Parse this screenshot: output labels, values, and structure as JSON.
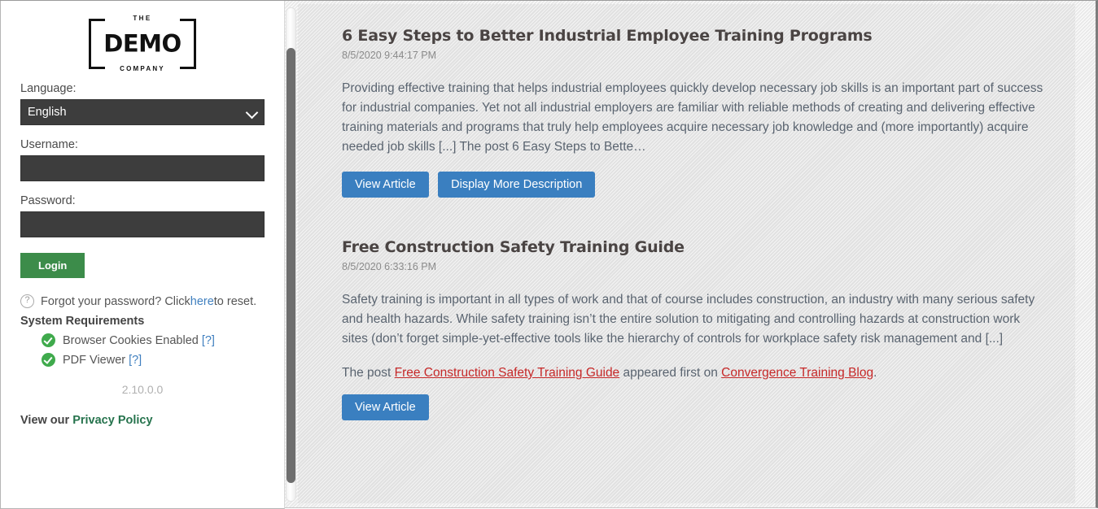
{
  "login": {
    "logo": {
      "top_text": "THE",
      "main_text": "DEMO",
      "bottom_text": "COMPANY"
    },
    "language_label": "Language:",
    "language_value": "English",
    "language_options": [
      "English"
    ],
    "username_label": "Username:",
    "username_value": "",
    "username_placeholder": "",
    "password_label": "Password:",
    "password_value": "",
    "password_placeholder": "",
    "login_button": "Login",
    "forgot": {
      "icon": "question-icon",
      "prefix": "Forgot your password? Click ",
      "link": "here",
      "suffix": " to reset."
    },
    "system_requirements_title": "System Requirements",
    "requirements": [
      {
        "icon": "check-circle-icon",
        "label": "Browser Cookies Enabled",
        "help": "[?]"
      },
      {
        "icon": "check-circle-icon",
        "label": "PDF Viewer",
        "help": "[?]"
      }
    ],
    "version": "2.10.0.0",
    "privacy": {
      "prefix": "View our ",
      "link": "Privacy Policy"
    }
  },
  "scrollbar": {
    "orientation": "vertical"
  },
  "content": {
    "articles": [
      {
        "title": "6 Easy Steps to Better Industrial Employee Training Programs",
        "date": "8/5/2020 9:44:17 PM",
        "body": "Providing effective training that helps industrial employees quickly develop necessary job skills is an important part of success for industrial companies. Yet not all industrial employers are familiar with reliable methods of creating and delivering effective training materials and programs that truly help employees acquire necessary job knowledge and (more importantly) acquire needed job skills [...] The post 6 Easy Steps to Bette…",
        "buttons": [
          "View Article",
          "Display More Description"
        ]
      },
      {
        "title": "Free Construction Safety Training Guide",
        "date": "8/5/2020 6:33:16 PM",
        "body": "Safety training is important in all types of work and that of course includes construction, an industry with many serious safety and health hazards. While safety training isn’t the entire solution to mitigating and controlling hazards at construction work sites (don’t forget simple-yet-effective tools like the hierarchy of controls for workplace safety risk management and [...]",
        "attribution": {
          "prefix": "The post ",
          "link1": "Free Construction Safety Training Guide",
          "middle": " appeared first on ",
          "link2": "Convergence Training Blog",
          "suffix": "."
        },
        "buttons": [
          "View Article"
        ]
      }
    ]
  },
  "colors": {
    "accent_blue": "#3a7fc0",
    "login_green": "#3c8c4a",
    "link_red": "#c62828",
    "input_dark": "#3d3d3d",
    "privacy_green": "#26734d"
  }
}
